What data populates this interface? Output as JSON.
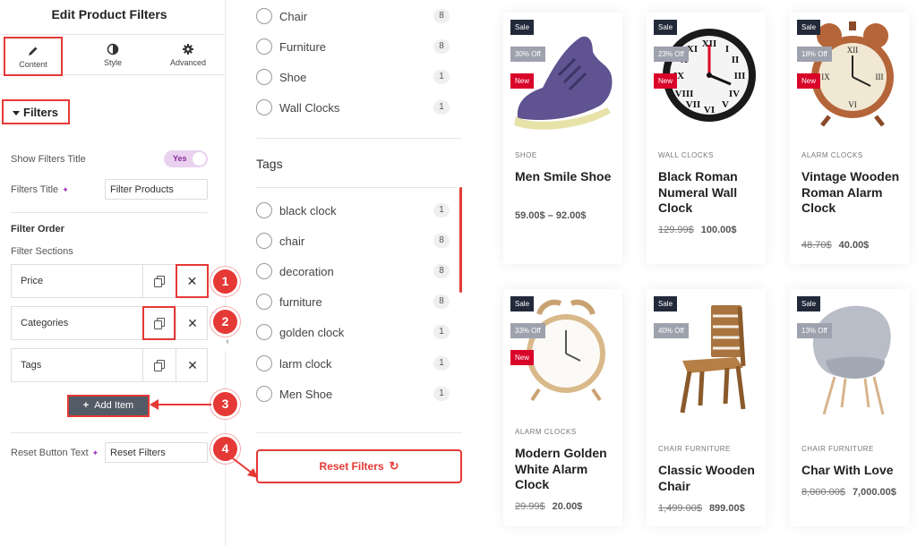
{
  "panel": {
    "title": "Edit Product Filters",
    "tabs": [
      {
        "label": "Content",
        "icon": "pencil-icon"
      },
      {
        "label": "Style",
        "icon": "half-circle-icon"
      },
      {
        "label": "Advanced",
        "icon": "gear-icon"
      }
    ],
    "section_title": "Filters",
    "show_filters_title_label": "Show Filters Title",
    "show_filters_title_value": "Yes",
    "filters_title_label": "Filters Title",
    "filters_title_value": "Filter Products",
    "filter_order_label": "Filter Order",
    "filter_sections_label": "Filter Sections",
    "sections": [
      {
        "label": "Price"
      },
      {
        "label": "Categories"
      },
      {
        "label": "Tags"
      }
    ],
    "add_item_label": "Add Item",
    "reset_button_text_label": "Reset Button Text",
    "reset_button_text_value": "Reset Filters"
  },
  "annotations": [
    "1",
    "2",
    "3",
    "4"
  ],
  "filters": {
    "categories": [
      {
        "name": "Chair",
        "count": "8"
      },
      {
        "name": "Furniture",
        "count": "8"
      },
      {
        "name": "Shoe",
        "count": "1"
      },
      {
        "name": "Wall Clocks",
        "count": "1"
      }
    ],
    "tags_title": "Tags",
    "tags": [
      {
        "name": "black clock",
        "count": "1"
      },
      {
        "name": "chair",
        "count": "8"
      },
      {
        "name": "decoration",
        "count": "8"
      },
      {
        "name": "furniture",
        "count": "8"
      },
      {
        "name": "golden clock",
        "count": "1"
      },
      {
        "name": "larm clock",
        "count": "1"
      },
      {
        "name": "Men Shoe",
        "count": "1"
      }
    ],
    "reset_label": "Reset Filters"
  },
  "products": [
    {
      "sale": "Sale",
      "off": "30% Off",
      "new": "New",
      "category": "SHOE",
      "name": "Men Smile Shoe",
      "price_old": "",
      "price": "59.00$ – 92.00$"
    },
    {
      "sale": "Sale",
      "off": "23% Off",
      "new": "New",
      "category": "WALL CLOCKS",
      "name": "Black Roman Numeral Wall Clock",
      "price_old": "129.99$",
      "price": "100.00$"
    },
    {
      "sale": "Sale",
      "off": "18% Off",
      "new": "New",
      "category": "ALARM CLOCKS",
      "name": "Vintage Wooden Roman Alarm Clock",
      "price_old": "48.70$",
      "price": "40.00$"
    },
    {
      "sale": "Sale",
      "off": "33% Off",
      "new": "New",
      "category": "ALARM CLOCKS",
      "name": "Modern Golden White Alarm Clock",
      "price_old": "29.99$",
      "price": "20.00$"
    },
    {
      "sale": "Sale",
      "off": "40% Off",
      "new": "",
      "category": "CHAIR   FURNITURE",
      "name": "Classic Wooden Chair",
      "price_old": "1,499.00$",
      "price": "899.00$"
    },
    {
      "sale": "Sale",
      "off": "13% Off",
      "new": "",
      "category": "CHAIR   FURNITURE",
      "name": "Char With Love",
      "price_old": "8,000.00$",
      "price": "7,000.00$"
    }
  ],
  "colors": {
    "accent": "#e53935",
    "dark": "#222a3a",
    "toggle": "#e9d1ef",
    "new_badge": "#d90429"
  }
}
